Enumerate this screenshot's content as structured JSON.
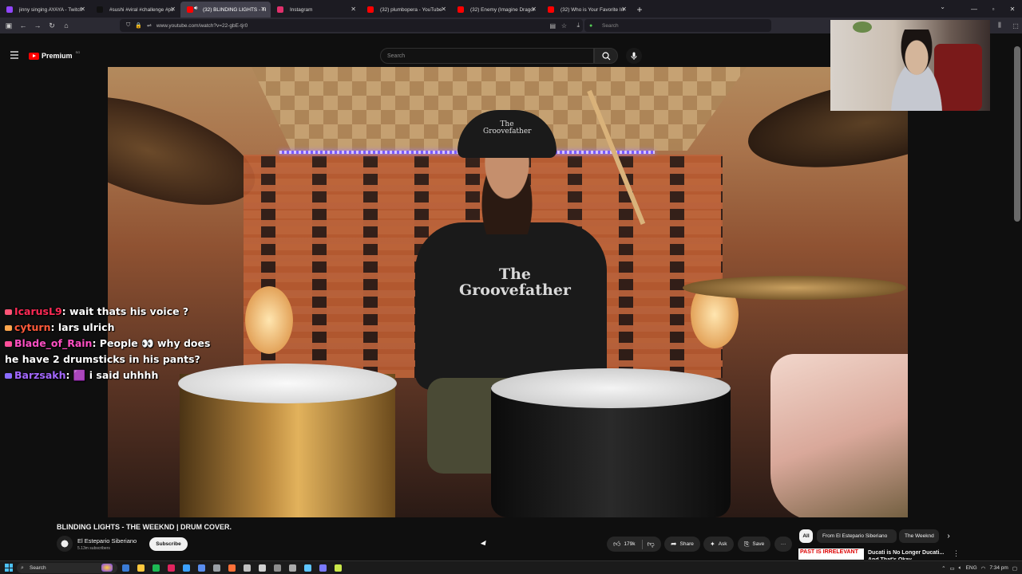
{
  "browser": {
    "tabs": [
      {
        "label": "jinny singing AYAYA - Twitch",
        "color": "#9146ff",
        "active": false,
        "audio": false
      },
      {
        "label": "#sushi #viral #challenge #puzz",
        "color": "#111111",
        "active": false,
        "audio": false
      },
      {
        "label": "(32) BLINDING LIGHTS - THE",
        "color": "#ff0000",
        "active": true,
        "audio": true
      },
      {
        "label": "Instagram",
        "color": "#e1306c",
        "active": false,
        "audio": false
      },
      {
        "label": "(32) plumbopera - YouTube",
        "color": "#ff0000",
        "active": false,
        "audio": false
      },
      {
        "label": "(32) Enemy (Imagine Dragons,",
        "color": "#ff0000",
        "active": false,
        "audio": false
      },
      {
        "label": "(32) Who is Your Favorite Indie",
        "color": "#ff0000",
        "active": false,
        "audio": false
      }
    ],
    "new_tab": "+",
    "url": "www.youtube.com/watch?v=22-gbE-tjr0",
    "search_placeholder": "Search"
  },
  "youtube": {
    "logo": "Premium",
    "logo_sup": "SG",
    "search_placeholder": "Search",
    "video_title": "BLINDING LIGHTS - THE WEEKND | DRUM COVER.",
    "channel_name": "El Estepario Siberiano",
    "subscribers": "5.13m subscribers",
    "subscribe": "Subscribe",
    "likes": "179k",
    "share": "Share",
    "ask": "Ask",
    "save": "Save",
    "more": "···",
    "chips": [
      "All",
      "From El Estepario Siberiano",
      "The Weeknd"
    ],
    "rec_thumb_text": "PAST IS IRRELEVANT",
    "rec_title": "Ducati is No Longer Ducati...",
    "rec_title2": "And That's Okay",
    "video_overlay": {
      "cap_text": "The Groovefather",
      "shirt_text": "The Groovefather"
    }
  },
  "chat": [
    {
      "user": "IcarusL9",
      "color": "#ff2a55",
      "badge": "#ff5577",
      "message": ": wait thats his voice ?"
    },
    {
      "user": "cyturn",
      "color": "#ff5a3a",
      "badge": "#ffa64d",
      "message": ": lars ulrich"
    },
    {
      "user": "Blade_of_Rain",
      "color": "#ff4fc3",
      "badge": "#ff4f9a",
      "message": ": People 👀 why does he have 2 drumsticks in his pants?"
    },
    {
      "user": "Barzsakh",
      "color": "#a468ff",
      "badge": "#8a6cff",
      "message": ": 🟪 i said uhhhh"
    }
  ],
  "taskbar": {
    "search": "Search",
    "lang": "ENG",
    "time": "7:34 pm"
  }
}
